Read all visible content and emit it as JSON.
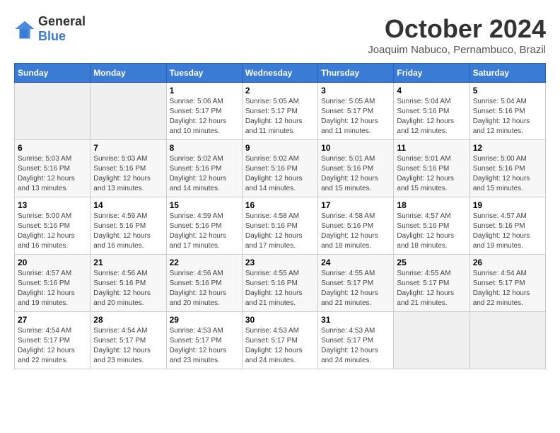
{
  "header": {
    "logo_general": "General",
    "logo_blue": "Blue",
    "month_title": "October 2024",
    "location": "Joaquim Nabuco, Pernambuco, Brazil"
  },
  "weekdays": [
    "Sunday",
    "Monday",
    "Tuesday",
    "Wednesday",
    "Thursday",
    "Friday",
    "Saturday"
  ],
  "weeks": [
    [
      {
        "day": "",
        "sunrise": "",
        "sunset": "",
        "daylight": ""
      },
      {
        "day": "",
        "sunrise": "",
        "sunset": "",
        "daylight": ""
      },
      {
        "day": "1",
        "sunrise": "Sunrise: 5:06 AM",
        "sunset": "Sunset: 5:17 PM",
        "daylight": "Daylight: 12 hours and 10 minutes."
      },
      {
        "day": "2",
        "sunrise": "Sunrise: 5:05 AM",
        "sunset": "Sunset: 5:17 PM",
        "daylight": "Daylight: 12 hours and 11 minutes."
      },
      {
        "day": "3",
        "sunrise": "Sunrise: 5:05 AM",
        "sunset": "Sunset: 5:17 PM",
        "daylight": "Daylight: 12 hours and 11 minutes."
      },
      {
        "day": "4",
        "sunrise": "Sunrise: 5:04 AM",
        "sunset": "Sunset: 5:16 PM",
        "daylight": "Daylight: 12 hours and 12 minutes."
      },
      {
        "day": "5",
        "sunrise": "Sunrise: 5:04 AM",
        "sunset": "Sunset: 5:16 PM",
        "daylight": "Daylight: 12 hours and 12 minutes."
      }
    ],
    [
      {
        "day": "6",
        "sunrise": "Sunrise: 5:03 AM",
        "sunset": "Sunset: 5:16 PM",
        "daylight": "Daylight: 12 hours and 13 minutes."
      },
      {
        "day": "7",
        "sunrise": "Sunrise: 5:03 AM",
        "sunset": "Sunset: 5:16 PM",
        "daylight": "Daylight: 12 hours and 13 minutes."
      },
      {
        "day": "8",
        "sunrise": "Sunrise: 5:02 AM",
        "sunset": "Sunset: 5:16 PM",
        "daylight": "Daylight: 12 hours and 14 minutes."
      },
      {
        "day": "9",
        "sunrise": "Sunrise: 5:02 AM",
        "sunset": "Sunset: 5:16 PM",
        "daylight": "Daylight: 12 hours and 14 minutes."
      },
      {
        "day": "10",
        "sunrise": "Sunrise: 5:01 AM",
        "sunset": "Sunset: 5:16 PM",
        "daylight": "Daylight: 12 hours and 15 minutes."
      },
      {
        "day": "11",
        "sunrise": "Sunrise: 5:01 AM",
        "sunset": "Sunset: 5:16 PM",
        "daylight": "Daylight: 12 hours and 15 minutes."
      },
      {
        "day": "12",
        "sunrise": "Sunrise: 5:00 AM",
        "sunset": "Sunset: 5:16 PM",
        "daylight": "Daylight: 12 hours and 15 minutes."
      }
    ],
    [
      {
        "day": "13",
        "sunrise": "Sunrise: 5:00 AM",
        "sunset": "Sunset: 5:16 PM",
        "daylight": "Daylight: 12 hours and 16 minutes."
      },
      {
        "day": "14",
        "sunrise": "Sunrise: 4:59 AM",
        "sunset": "Sunset: 5:16 PM",
        "daylight": "Daylight: 12 hours and 16 minutes."
      },
      {
        "day": "15",
        "sunrise": "Sunrise: 4:59 AM",
        "sunset": "Sunset: 5:16 PM",
        "daylight": "Daylight: 12 hours and 17 minutes."
      },
      {
        "day": "16",
        "sunrise": "Sunrise: 4:58 AM",
        "sunset": "Sunset: 5:16 PM",
        "daylight": "Daylight: 12 hours and 17 minutes."
      },
      {
        "day": "17",
        "sunrise": "Sunrise: 4:58 AM",
        "sunset": "Sunset: 5:16 PM",
        "daylight": "Daylight: 12 hours and 18 minutes."
      },
      {
        "day": "18",
        "sunrise": "Sunrise: 4:57 AM",
        "sunset": "Sunset: 5:16 PM",
        "daylight": "Daylight: 12 hours and 18 minutes."
      },
      {
        "day": "19",
        "sunrise": "Sunrise: 4:57 AM",
        "sunset": "Sunset: 5:16 PM",
        "daylight": "Daylight: 12 hours and 19 minutes."
      }
    ],
    [
      {
        "day": "20",
        "sunrise": "Sunrise: 4:57 AM",
        "sunset": "Sunset: 5:16 PM",
        "daylight": "Daylight: 12 hours and 19 minutes."
      },
      {
        "day": "21",
        "sunrise": "Sunrise: 4:56 AM",
        "sunset": "Sunset: 5:16 PM",
        "daylight": "Daylight: 12 hours and 20 minutes."
      },
      {
        "day": "22",
        "sunrise": "Sunrise: 4:56 AM",
        "sunset": "Sunset: 5:16 PM",
        "daylight": "Daylight: 12 hours and 20 minutes."
      },
      {
        "day": "23",
        "sunrise": "Sunrise: 4:55 AM",
        "sunset": "Sunset: 5:16 PM",
        "daylight": "Daylight: 12 hours and 21 minutes."
      },
      {
        "day": "24",
        "sunrise": "Sunrise: 4:55 AM",
        "sunset": "Sunset: 5:17 PM",
        "daylight": "Daylight: 12 hours and 21 minutes."
      },
      {
        "day": "25",
        "sunrise": "Sunrise: 4:55 AM",
        "sunset": "Sunset: 5:17 PM",
        "daylight": "Daylight: 12 hours and 21 minutes."
      },
      {
        "day": "26",
        "sunrise": "Sunrise: 4:54 AM",
        "sunset": "Sunset: 5:17 PM",
        "daylight": "Daylight: 12 hours and 22 minutes."
      }
    ],
    [
      {
        "day": "27",
        "sunrise": "Sunrise: 4:54 AM",
        "sunset": "Sunset: 5:17 PM",
        "daylight": "Daylight: 12 hours and 22 minutes."
      },
      {
        "day": "28",
        "sunrise": "Sunrise: 4:54 AM",
        "sunset": "Sunset: 5:17 PM",
        "daylight": "Daylight: 12 hours and 23 minutes."
      },
      {
        "day": "29",
        "sunrise": "Sunrise: 4:53 AM",
        "sunset": "Sunset: 5:17 PM",
        "daylight": "Daylight: 12 hours and 23 minutes."
      },
      {
        "day": "30",
        "sunrise": "Sunrise: 4:53 AM",
        "sunset": "Sunset: 5:17 PM",
        "daylight": "Daylight: 12 hours and 24 minutes."
      },
      {
        "day": "31",
        "sunrise": "Sunrise: 4:53 AM",
        "sunset": "Sunset: 5:17 PM",
        "daylight": "Daylight: 12 hours and 24 minutes."
      },
      {
        "day": "",
        "sunrise": "",
        "sunset": "",
        "daylight": ""
      },
      {
        "day": "",
        "sunrise": "",
        "sunset": "",
        "daylight": ""
      }
    ]
  ]
}
